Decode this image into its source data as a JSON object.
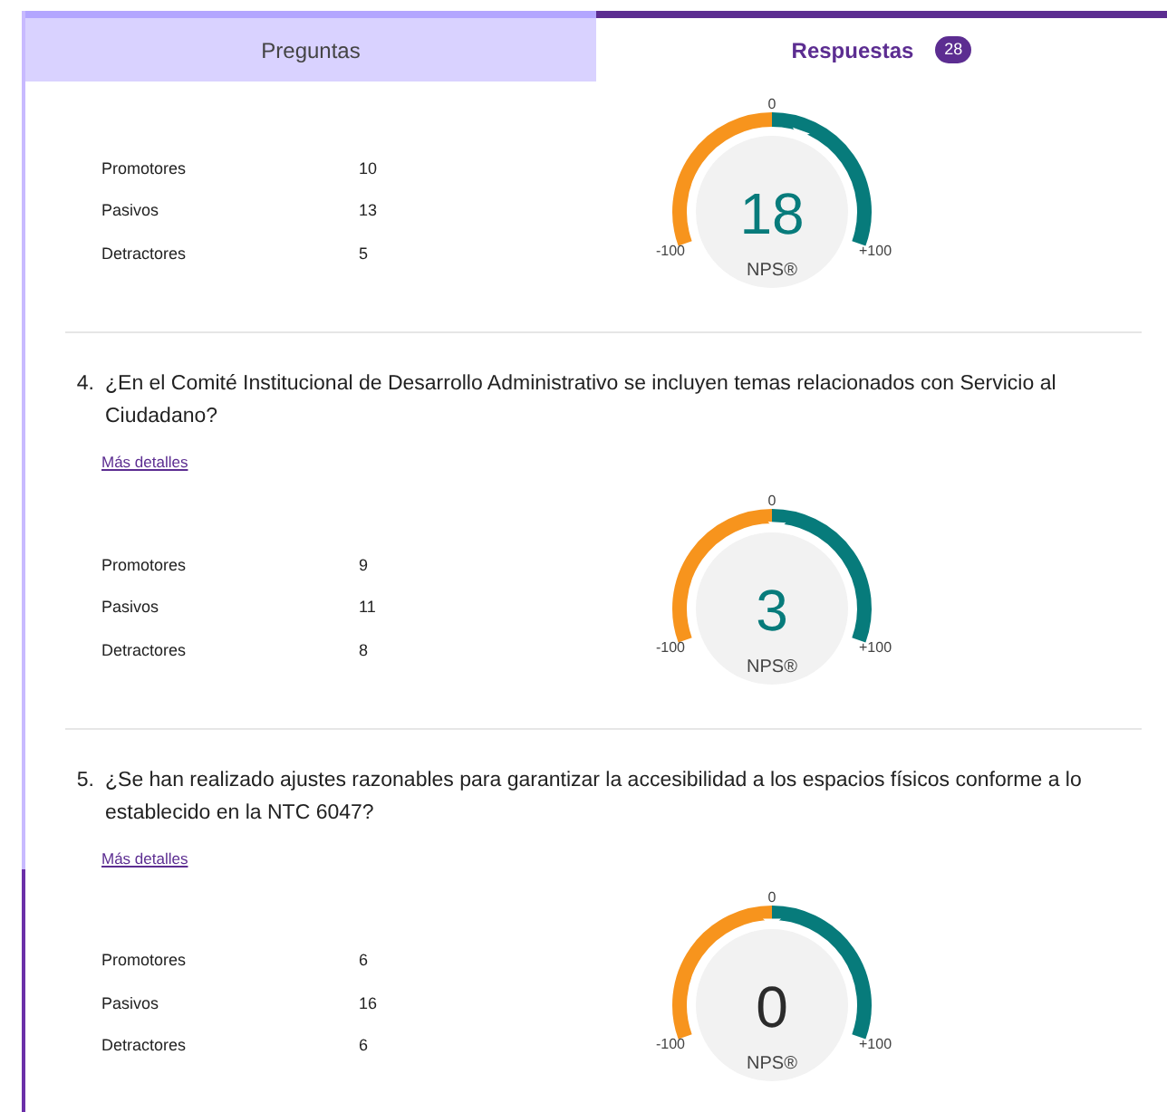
{
  "tabs": [
    {
      "label": "Preguntas",
      "selected": false
    },
    {
      "label": "Respuestas",
      "count": "28",
      "selected": true
    }
  ],
  "questions": [
    {
      "stats": [
        {
          "label": "Promotores",
          "value": "10"
        },
        {
          "label": "Pasivos",
          "value": "13"
        },
        {
          "label": "Detractores",
          "value": "5"
        }
      ],
      "gauge": {
        "score": "18",
        "kind": "positive",
        "level": 0.59,
        "zero_label": "0",
        "min_label": "-100",
        "max_label": "+100",
        "unit": "NPS®"
      }
    },
    {
      "number": "4.",
      "text": "¿En el Comité Institucional de Desarrollo Administrativo se incluyen temas relacionados con Servicio al Ciudadano?",
      "link": "Más detalles",
      "stats": [
        {
          "label": "Promotores",
          "value": "9"
        },
        {
          "label": "Pasivos",
          "value": "11"
        },
        {
          "label": "Detractores",
          "value": "8"
        }
      ],
      "gauge": {
        "score": "3",
        "kind": "positive",
        "level": 0.515,
        "zero_label": "0",
        "min_label": "-100",
        "max_label": "+100",
        "unit": "NPS®"
      }
    },
    {
      "number": "5.",
      "text": "¿Se han realizado ajustes razonables para garantizar la accesibilidad a los espacios físicos conforme a lo establecido en la NTC 6047?",
      "link": "Más detalles",
      "stats": [
        {
          "label": "Promotores",
          "value": "6"
        },
        {
          "label": "Pasivos",
          "value": "16"
        },
        {
          "label": "Detractores",
          "value": "6"
        }
      ],
      "gauge": {
        "score": "0",
        "kind": "neutral",
        "level": 0.5,
        "zero_label": "0",
        "min_label": "-100",
        "max_label": "+100",
        "unit": "NPS®"
      }
    }
  ]
}
